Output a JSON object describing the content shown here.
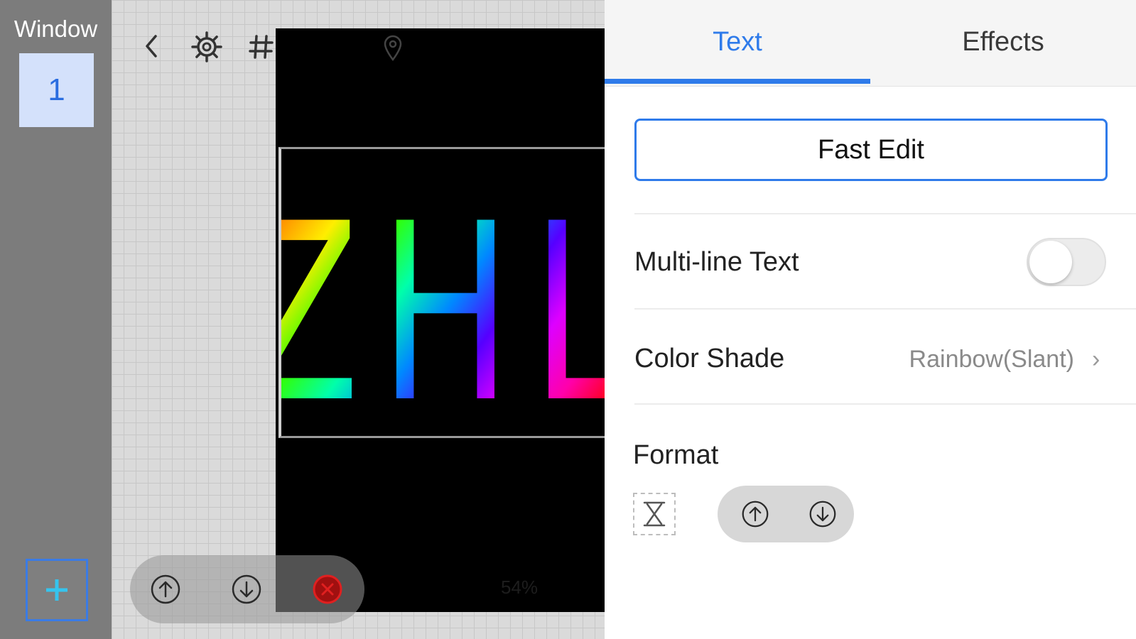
{
  "window_sidebar": {
    "title": "Window",
    "tiles": [
      {
        "label": "1"
      }
    ],
    "add_icon": "plus-icon"
  },
  "canvas": {
    "toolbar_icons": [
      "chevron-left-icon",
      "gear-icon",
      "grid-icon",
      "location-pin-icon"
    ],
    "display_text": "ZHL",
    "bottom_controls": [
      "move-up-icon",
      "move-down-icon",
      "delete-icon"
    ],
    "zoom_label": "54%"
  },
  "panel": {
    "tabs": [
      {
        "label": "Text",
        "active": true
      },
      {
        "label": "Effects",
        "active": false
      }
    ],
    "fast_edit_label": "Fast Edit",
    "multiline": {
      "label": "Multi-line Text",
      "enabled": false
    },
    "color_shade": {
      "label": "Color Shade",
      "value": "Rainbow(Slant)"
    },
    "format": {
      "label": "Format",
      "icons": [
        "text-height-icon",
        "move-up-icon",
        "move-down-icon"
      ]
    }
  },
  "colors": {
    "accent": "#2f7bea",
    "sidebar": "#7c7c7c",
    "delete_red": "#e02020"
  }
}
